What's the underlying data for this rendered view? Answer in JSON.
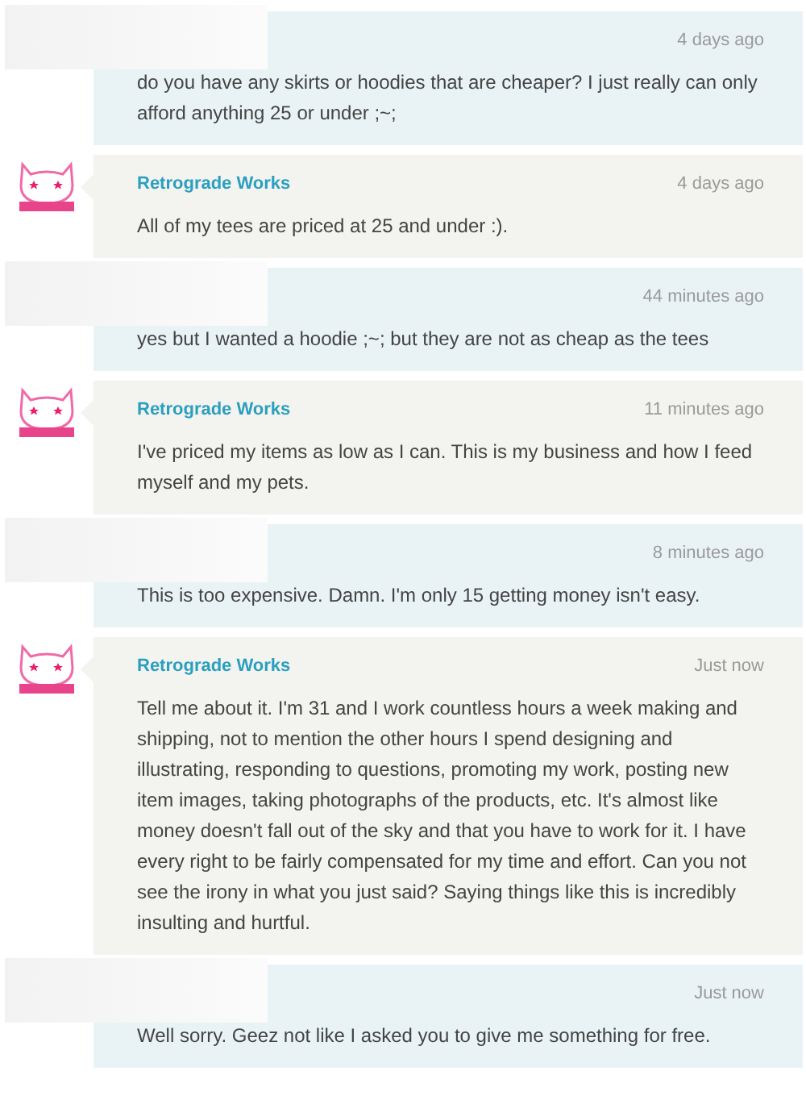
{
  "messages": [
    {
      "kind": "customer",
      "time": "4 days ago",
      "text": "do you have any skirts or hoodies that are cheaper? I just really can only afford anything 25 or under ;~;"
    },
    {
      "kind": "shop",
      "author": "Retrograde Works",
      "time": "4 days ago",
      "text": "All of my tees are priced at 25 and under :)."
    },
    {
      "kind": "customer",
      "time": "44 minutes ago",
      "text": "yes but I wanted a hoodie ;~; but they are not as cheap as the tees"
    },
    {
      "kind": "shop",
      "author": "Retrograde Works",
      "time": "11 minutes ago",
      "text": "I've priced my items as low as I can. This is my business and how I feed myself and my pets."
    },
    {
      "kind": "customer",
      "time": "8 minutes ago",
      "text": "This is too expensive. Damn. I'm only 15 getting money isn't easy."
    },
    {
      "kind": "shop",
      "author": "Retrograde Works",
      "time": "Just now",
      "text": "Tell me about it. I'm 31 and I work countless hours a week making and shipping, not to mention the other hours I spend designing and illustrating, responding to questions, promoting my work, posting new item images, taking photographs of the products, etc. It's almost like money doesn't fall out of the sky and that you have to work for it. I have every right to be fairly compensated for my time and effort. Can you not see the irony in what you just said? Saying things like this is incredibly insulting and hurtful."
    },
    {
      "kind": "customer",
      "time": "Just now",
      "text": "Well sorry. Geez not like I asked you to give me something for free."
    }
  ]
}
